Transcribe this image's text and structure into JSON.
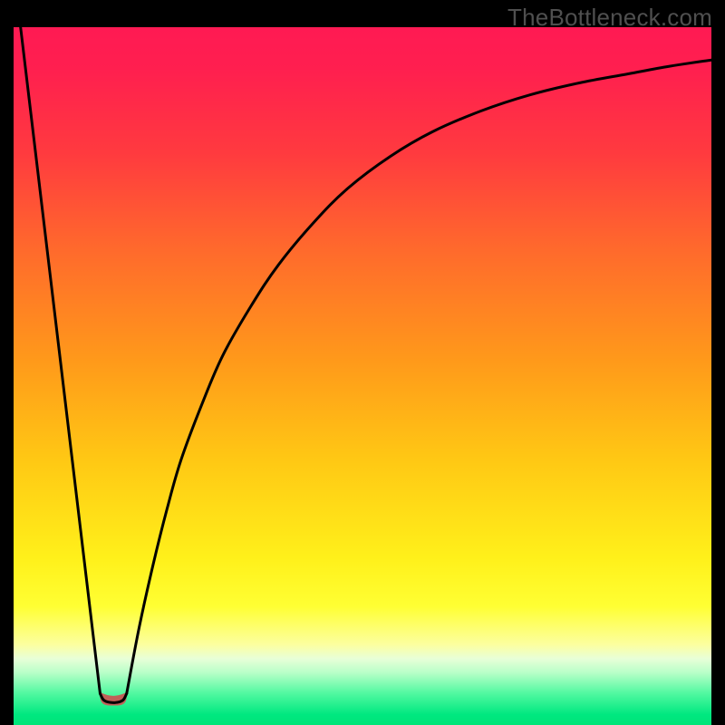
{
  "watermark": "TheBottleneck.com",
  "colors": {
    "bg": "#000000",
    "curve": "#000000",
    "marker_fill": "#c06058",
    "gradient_stops": [
      {
        "offset": 0.0,
        "color": "#ff1a53"
      },
      {
        "offset": 0.06,
        "color": "#ff1f4f"
      },
      {
        "offset": 0.18,
        "color": "#ff3a3f"
      },
      {
        "offset": 0.32,
        "color": "#ff6a2c"
      },
      {
        "offset": 0.48,
        "color": "#ff9a1a"
      },
      {
        "offset": 0.62,
        "color": "#ffc814"
      },
      {
        "offset": 0.76,
        "color": "#fff01a"
      },
      {
        "offset": 0.83,
        "color": "#ffff33"
      },
      {
        "offset": 0.885,
        "color": "#fcffa0"
      },
      {
        "offset": 0.905,
        "color": "#e8ffd8"
      },
      {
        "offset": 0.925,
        "color": "#b8ffc8"
      },
      {
        "offset": 0.955,
        "color": "#50f8a0"
      },
      {
        "offset": 0.985,
        "color": "#00e880"
      },
      {
        "offset": 1.0,
        "color": "#00e478"
      }
    ]
  },
  "chart_data": {
    "type": "line",
    "title": "",
    "xlabel": "",
    "ylabel": "",
    "xlim": [
      0,
      100
    ],
    "ylim": [
      0,
      100
    ],
    "legend": false,
    "grid": false,
    "annotations": [
      "TheBottleneck.com"
    ],
    "series": [
      {
        "name": "left-branch",
        "x": [
          1.0,
          12.4
        ],
        "values": [
          100,
          4.5
        ]
      },
      {
        "name": "right-branch",
        "x": [
          16.2,
          18,
          20,
          22,
          24,
          27,
          30,
          34,
          38,
          43,
          48,
          54,
          60,
          67,
          74,
          81,
          88,
          94,
          100
        ],
        "values": [
          4.5,
          14,
          23,
          31,
          38,
          46,
          53,
          60,
          66,
          72,
          77,
          81.5,
          85,
          88,
          90.3,
          92,
          93.3,
          94.4,
          95.3
        ]
      },
      {
        "name": "valley-floor",
        "x": [
          12.4,
          13.0,
          14.3,
          15.6,
          16.2
        ],
        "values": [
          4.5,
          3.5,
          3.2,
          3.5,
          4.5
        ]
      }
    ],
    "marker": {
      "name": "valley-marker",
      "cx": 14.3,
      "x_left": 12.4,
      "x_right": 16.2,
      "y_top": 4.7,
      "y_bottom": 2.8,
      "corner_r_pct": 1.3
    }
  }
}
